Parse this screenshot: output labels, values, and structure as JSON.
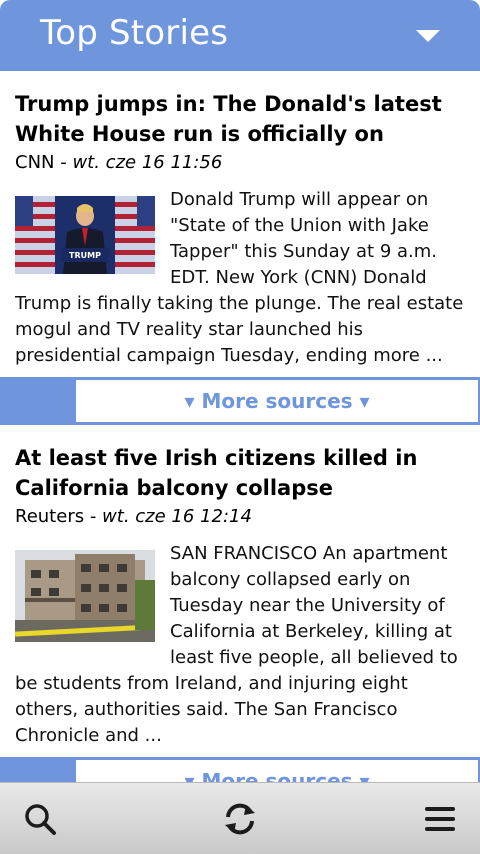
{
  "header": {
    "title": "Top Stories",
    "dropdown_icon": "chevron-down-icon"
  },
  "stories": [
    {
      "title": "Trump jumps in: The Donald's latest White House run is officially on",
      "source": "CNN",
      "separator": " - ",
      "date": "wt. cze 16 11:56",
      "thumb_caption": "TRUMP",
      "body": "Donald Trump will appear on \"State of the Union with Jake Tapper\" this Sunday at 9 a.m. EDT. New York (CNN) Donald Trump is finally taking the plunge. The real estate mogul and TV reality star launched his presidential campaign Tuesday, ending more ...",
      "more_sources": "▾ More sources ▾"
    },
    {
      "title": "At least five Irish citizens killed in California balcony collapse",
      "source": "Reuters",
      "separator": " - ",
      "date": "wt. cze 16 12:14",
      "body": "SAN FRANCISCO An apartment balcony collapsed early on Tuesday near the University of California at Berkeley, killing at least five people, all believed to be students from Ireland, and injuring eight others, authorities said. The San Francisco Chronicle and ...",
      "more_sources": "▾ More sources ▾"
    }
  ],
  "toolbar": {
    "search_icon": "search-icon",
    "refresh_icon": "refresh-icon",
    "menu_icon": "menu-icon"
  },
  "colors": {
    "accent": "#6f95dc"
  }
}
